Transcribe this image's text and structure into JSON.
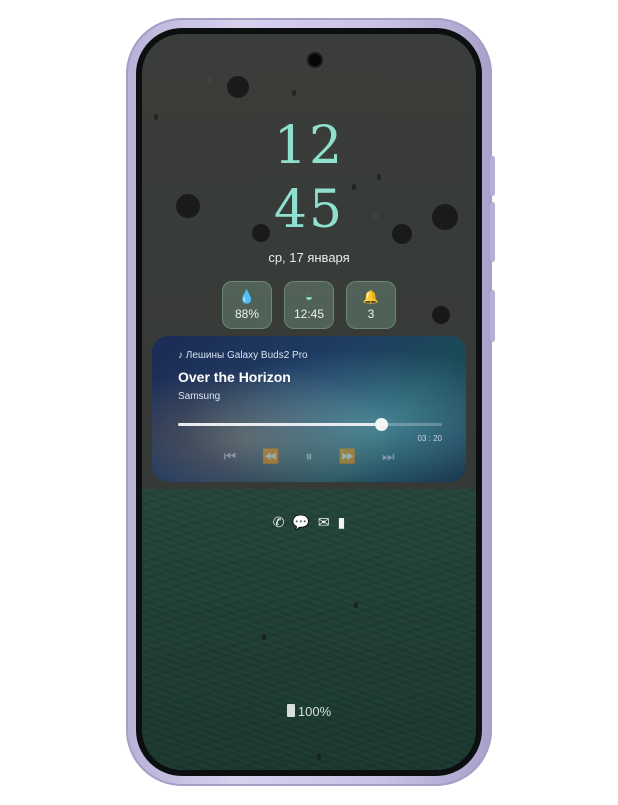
{
  "lockscreen": {
    "time_hours": "12",
    "time_minutes": "45",
    "date": "ср, 17 января"
  },
  "widgets": [
    {
      "icon": "droplet-icon",
      "glyph": "💧",
      "value": "88%"
    },
    {
      "icon": "sunrise-icon",
      "glyph": "◒",
      "value": "12:45"
    },
    {
      "icon": "bell-icon",
      "glyph": "🔔",
      "value": "3"
    }
  ],
  "media": {
    "source": "♪ Лешины Galaxy Buds2 Pro",
    "title": "Over the Horizon",
    "artist": "Samsung",
    "progress": 0.77,
    "remaining": "03 : 20"
  },
  "notifications": [
    {
      "icon": "missed-call-icon",
      "glyph": "✆"
    },
    {
      "icon": "message-icon",
      "glyph": "💬"
    },
    {
      "icon": "mail-icon",
      "glyph": "✉"
    },
    {
      "icon": "sim-icon",
      "glyph": "▮"
    }
  ],
  "battery": {
    "label": "100%"
  },
  "colors": {
    "clock": "#8fe0cf",
    "frame": "#c9c2e6"
  }
}
